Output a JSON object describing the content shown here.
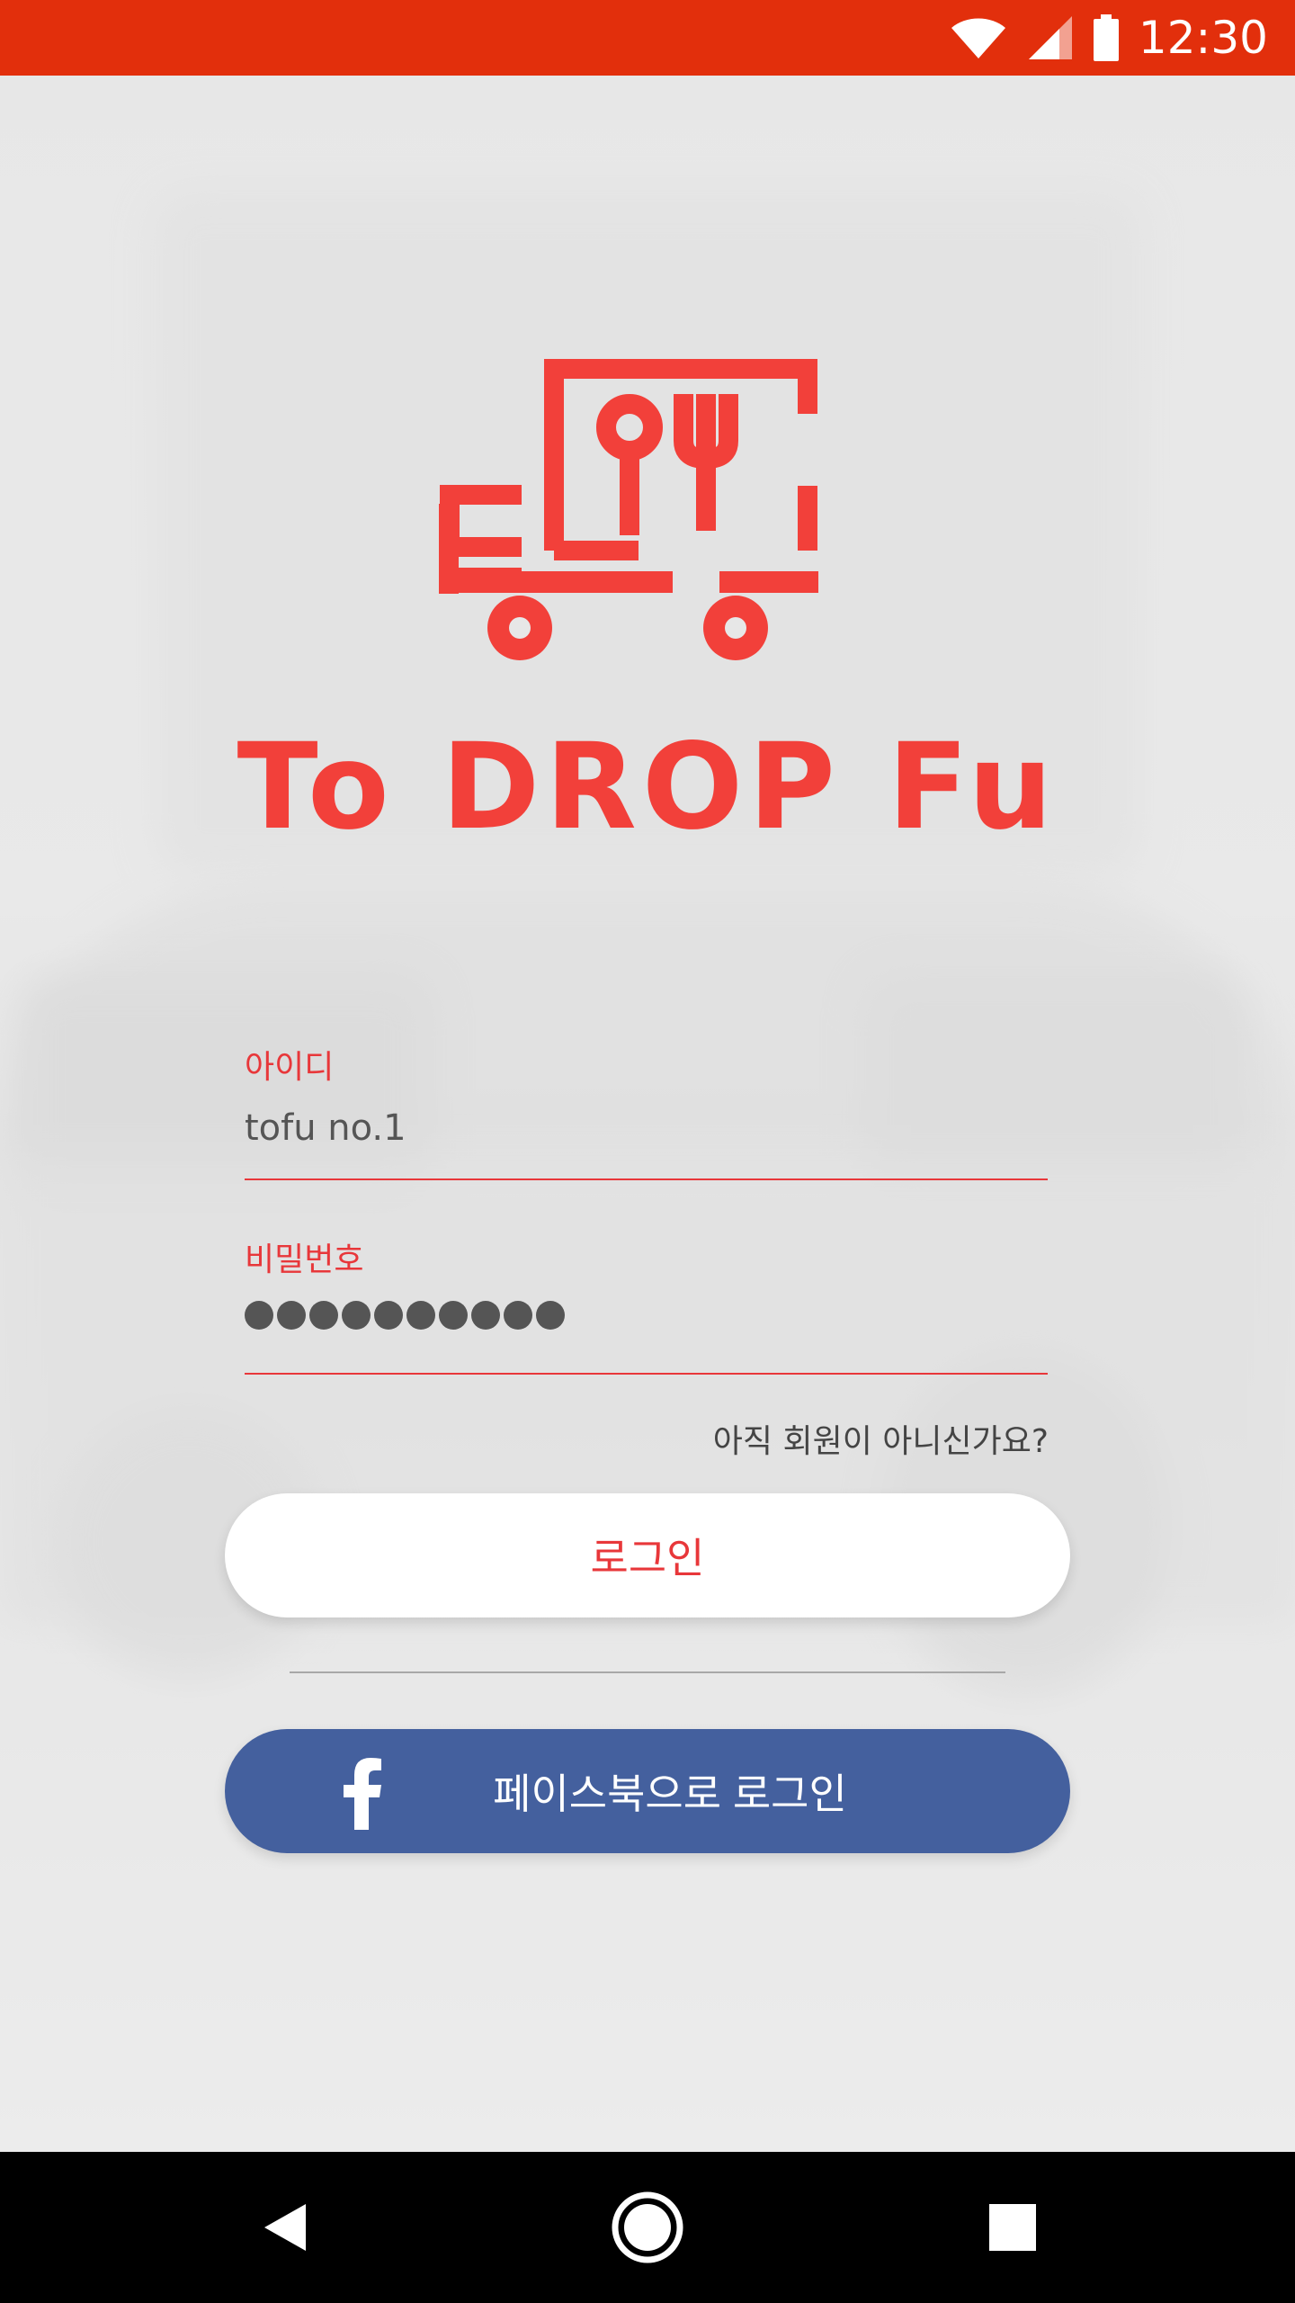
{
  "status_bar": {
    "time": "12:30",
    "icons": [
      "wifi-icon",
      "signal-icon",
      "battery-icon"
    ]
  },
  "brand": {
    "wordmark": "To DROP Fu",
    "logo_icon": "food-truck-icon",
    "color": "#f2403a"
  },
  "form": {
    "id_label": "아이디",
    "id_value": "tofu no.1",
    "password_label": "비밀번호",
    "password_masked_length": 10,
    "signup_link": "아직 회원이 아니신가요?",
    "login_button": "로그인",
    "facebook_button": "페이스북으로 로그인",
    "facebook_icon": "facebook-icon"
  },
  "colors": {
    "status_bar": "#e22f0c",
    "accent": "#e8373a",
    "facebook": "#44609e"
  },
  "nav_bar": {
    "buttons": [
      "back-icon",
      "home-icon",
      "recent-apps-icon"
    ]
  }
}
